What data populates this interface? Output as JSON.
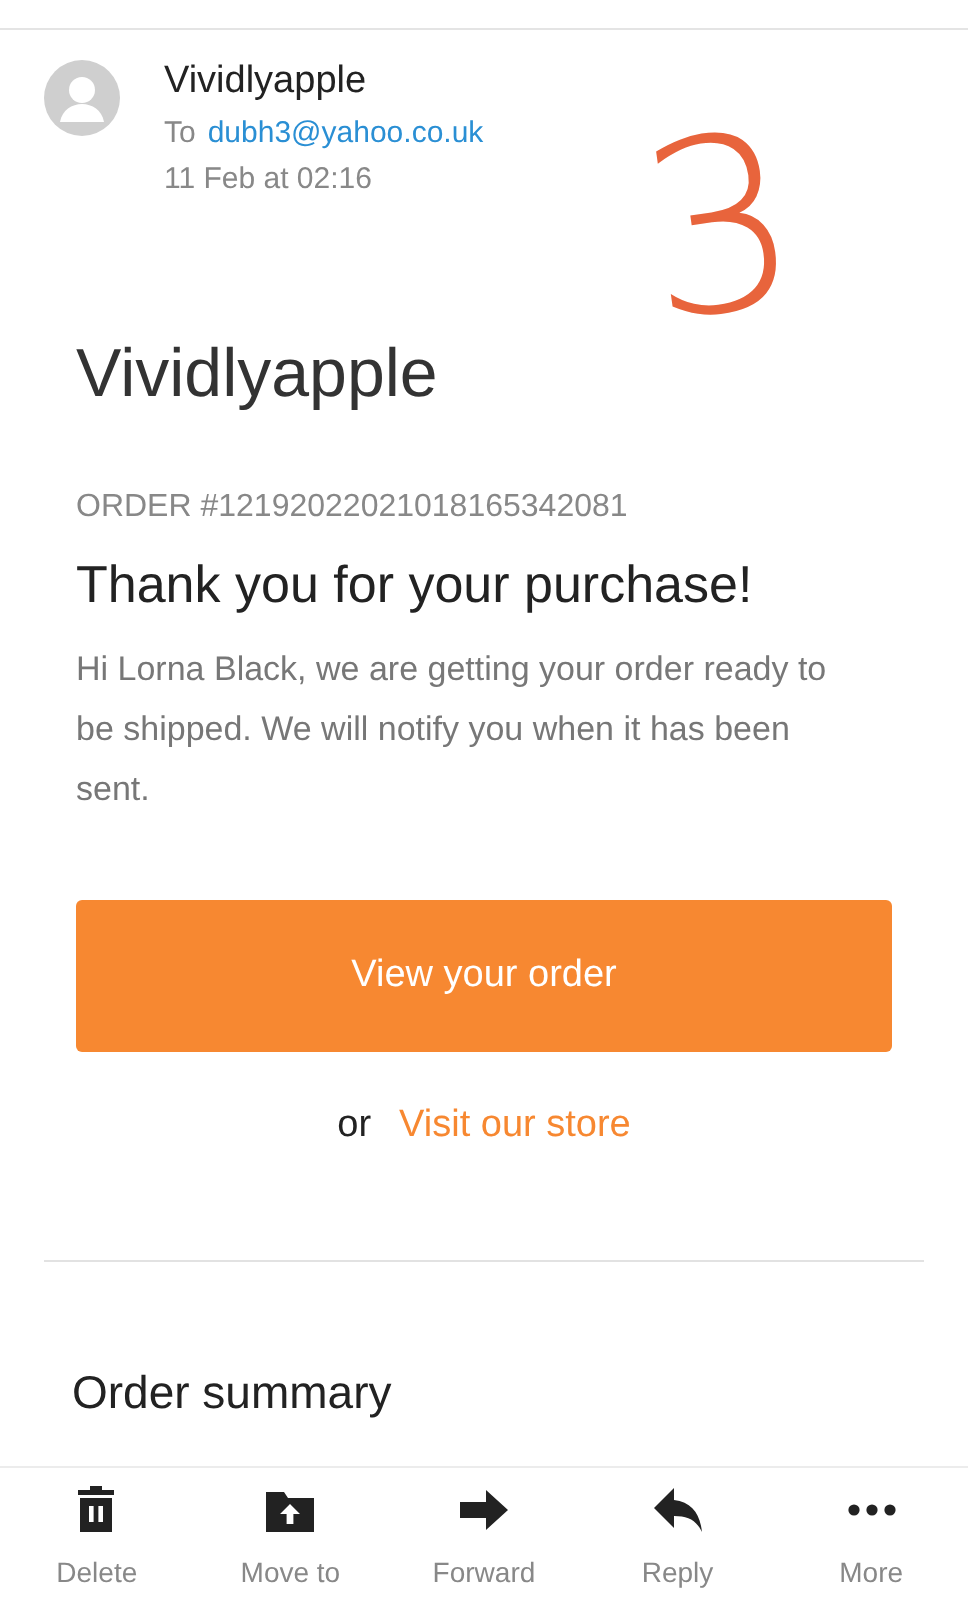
{
  "email": {
    "sender": "Vividlyapple",
    "to_label": "To",
    "to_address": "dubh3@yahoo.co.uk",
    "date": "11 Feb at 02:16"
  },
  "annotation": "3",
  "body": {
    "brand": "Vividlyapple",
    "order_number": "ORDER #12192022021018165342081",
    "heading": "Thank you for your purchase!",
    "message": "Hi Lorna Black, we are getting your order ready to be shipped. We will notify you when it has been sent.",
    "primary_button": "View your order",
    "or_text": "or",
    "store_link": "Visit our store",
    "section_title": "Order summary"
  },
  "actions": [
    {
      "kind": "delete",
      "label": "Delete"
    },
    {
      "kind": "move",
      "label": "Move to"
    },
    {
      "kind": "forward",
      "label": "Forward"
    },
    {
      "kind": "reply",
      "label": "Reply"
    },
    {
      "kind": "more",
      "label": "More"
    }
  ]
}
